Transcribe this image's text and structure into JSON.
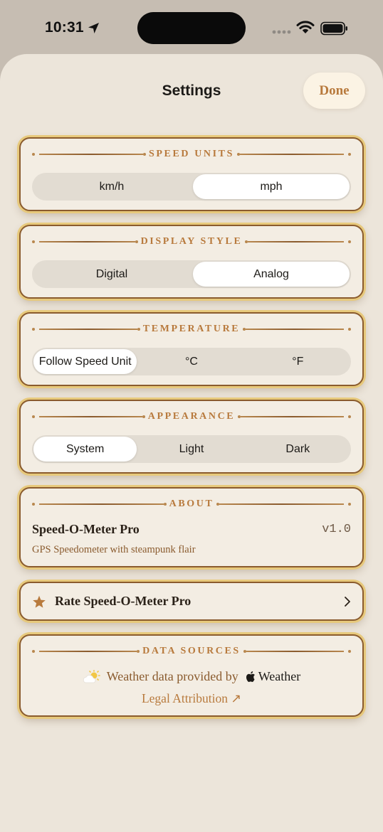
{
  "status_bar": {
    "time": "10:31"
  },
  "nav": {
    "title": "Settings",
    "done_label": "Done"
  },
  "sections": {
    "speed_units": {
      "title": "SPEED UNITS",
      "options": [
        "km/h",
        "mph"
      ],
      "selected": "mph"
    },
    "display_style": {
      "title": "DISPLAY STYLE",
      "options": [
        "Digital",
        "Analog"
      ],
      "selected": "Analog"
    },
    "temperature": {
      "title": "TEMPERATURE",
      "options": [
        "Follow Speed Unit",
        "°C",
        "°F"
      ],
      "selected": "Follow Speed Unit"
    },
    "appearance": {
      "title": "APPEARANCE",
      "options": [
        "System",
        "Light",
        "Dark"
      ],
      "selected": "System"
    }
  },
  "about": {
    "title": "ABOUT",
    "app_name": "Speed-O-Meter Pro",
    "version": "v1.0",
    "description": "GPS Speedometer with steampunk flair"
  },
  "rate": {
    "label": "Rate Speed-O-Meter Pro"
  },
  "data_sources": {
    "title": "DATA SOURCES",
    "provided_by": "Weather data provided by",
    "brand": "Weather",
    "legal_label": "Legal Attribution ↗"
  },
  "colors": {
    "accent": "#b87a3d",
    "brass": "#e7c97c",
    "border": "#8a5b2e",
    "sheet_bg": "#ece5da"
  },
  "icons": {
    "location": "location-arrow-icon",
    "wifi": "wifi-icon",
    "battery": "battery-icon",
    "star": "star-icon",
    "chevron": "chevron-right-icon",
    "weather": "partly-sunny-icon",
    "apple": "apple-logo-icon"
  }
}
